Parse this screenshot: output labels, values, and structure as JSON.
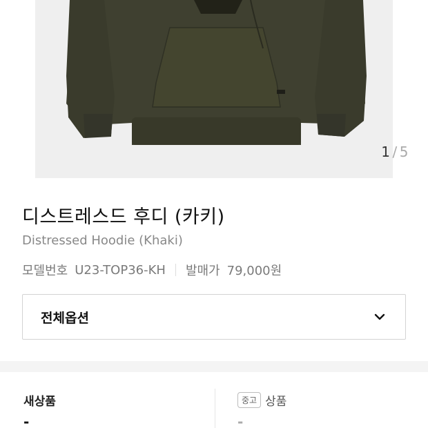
{
  "gallery": {
    "current": "1",
    "separator": "/",
    "total": "5"
  },
  "product": {
    "name_ko": "디스트레스드 후디 (카키)",
    "name_en": "Distressed Hoodie (Khaki)",
    "model_label": "모델번호",
    "model_value": "U23-TOP36-KH",
    "release_label": "발매가",
    "release_value": "79,000원",
    "color_hex": "#3f4030"
  },
  "options": {
    "select_label": "전체옵션"
  },
  "prices": {
    "new": {
      "label": "새상품",
      "value": "-"
    },
    "used": {
      "badge": "중고",
      "label": "상품",
      "value": "-"
    }
  }
}
